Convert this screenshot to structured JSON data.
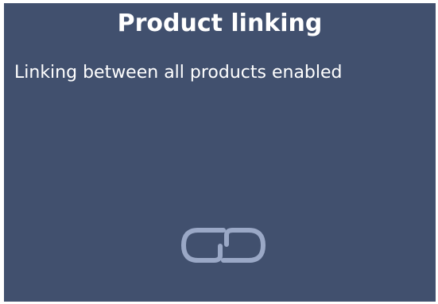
{
  "panel": {
    "title": "Product linking",
    "description": "Linking between all products enabled",
    "icon": "link-icon",
    "colors": {
      "background": "#41506e",
      "text": "#ffffff",
      "icon": "#9aa8c6"
    }
  }
}
